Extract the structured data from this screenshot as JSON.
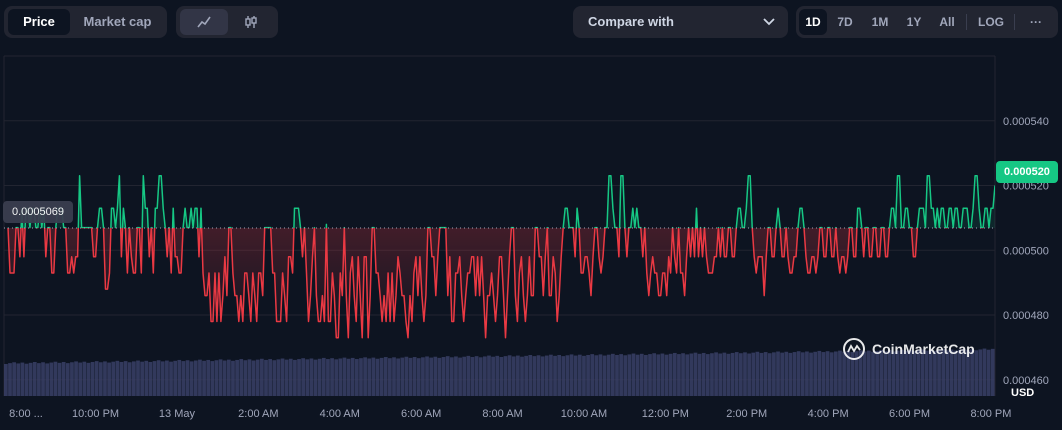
{
  "toolbar": {
    "view_tabs": [
      "Price",
      "Market cap"
    ],
    "active_view": "Price",
    "chart_styles": [
      "line-chart-icon",
      "candlestick-icon"
    ],
    "compare_label": "Compare with",
    "ranges": [
      "1D",
      "7D",
      "1M",
      "1Y",
      "All"
    ],
    "active_range": "1D",
    "log_label": "LOG",
    "more_label": "···"
  },
  "current_price_label": "0.000520",
  "reference_price_label": "0.0005069",
  "watermark": "CoinMarketCap",
  "currency": "USD",
  "colors": {
    "up": "#16c784",
    "down": "#ea3943",
    "background": "#0d1421",
    "grid": "#222531",
    "volume": "#3a3f66"
  },
  "chart_data": {
    "type": "line",
    "title": "",
    "xlabel": "",
    "ylabel": "USD",
    "reference_value": 0.0005069,
    "ylim": [
      0.000455,
      0.00056
    ],
    "ytick_values": [
      0.00046,
      0.00048,
      0.0005,
      0.00052,
      0.00054
    ],
    "ytick_labels": [
      "0.000460",
      "0.000480",
      "0.000500",
      "0.000520",
      "0.000540"
    ],
    "xtick_labels": [
      "8:00 ...",
      "10:00 PM",
      "13 May",
      "2:00 AM",
      "4:00 AM",
      "6:00 AM",
      "8:00 AM",
      "10:00 AM",
      "12:00 PM",
      "2:00 PM",
      "4:00 PM",
      "6:00 PM",
      "8:00 PM"
    ],
    "xtick_hours": [
      20,
      22,
      24,
      26,
      28,
      30,
      32,
      34,
      36,
      38,
      40,
      42,
      44
    ],
    "x_range_hours": [
      19.75,
      44.1
    ],
    "series": [
      {
        "values": [
          0.000507,
          0.000493,
          0.000493,
          0.000493,
          0.000507,
          0.000507,
          0.000498,
          0.000513,
          0.000498,
          0.000513,
          0.000513,
          0.000507,
          0.000513,
          0.000513,
          0.000507,
          0.000507,
          0.000513,
          0.000507,
          0.000513,
          0.000498,
          0.000507,
          0.000507,
          0.000493,
          0.000493,
          0.000507,
          0.000513,
          0.000513,
          0.000513,
          0.000507,
          0.000507,
          0.000493,
          0.000493,
          0.000498,
          0.000493,
          0.000498,
          0.000498,
          0.000523,
          0.000507,
          0.000507,
          0.000507,
          0.000507,
          0.000507,
          0.000507,
          0.000498,
          0.000498,
          0.000507,
          0.000513,
          0.000513,
          0.000507,
          0.000488,
          0.000488,
          0.000493,
          0.000513,
          0.000513,
          0.000507,
          0.000513,
          0.000523,
          0.000498,
          0.000513,
          0.000507,
          0.000493,
          0.000507,
          0.000498,
          0.000493,
          0.000493,
          0.000507,
          0.000507,
          0.000493,
          0.000523,
          0.000513,
          0.000513,
          0.000498,
          0.000507,
          0.000493,
          0.000513,
          0.000513,
          0.000523,
          0.000523,
          0.000513,
          0.000507,
          0.000498,
          0.000507,
          0.000493,
          0.000513,
          0.000498,
          0.000498,
          0.000493,
          0.000493,
          0.000507,
          0.000513,
          0.000507,
          0.000507,
          0.000513,
          0.000507,
          0.000513,
          0.000513,
          0.000498,
          0.000513,
          0.000493,
          0.000486,
          0.000486,
          0.000493,
          0.000478,
          0.000478,
          0.000493,
          0.000478,
          0.000493,
          0.000478,
          0.000486,
          0.000498,
          0.000486,
          0.000507,
          0.000507,
          0.000493,
          0.000486,
          0.000486,
          0.000478,
          0.000486,
          0.000478,
          0.000493,
          0.000493,
          0.000486,
          0.000478,
          0.000493,
          0.000486,
          0.000478,
          0.000493,
          0.000493,
          0.000486,
          0.000507,
          0.000507,
          0.000507,
          0.000507,
          0.000493,
          0.000493,
          0.000478,
          0.000478,
          0.000478,
          0.000493,
          0.000486,
          0.000478,
          0.000498,
          0.000498,
          0.000493,
          0.000513,
          0.000513,
          0.000513,
          0.000507,
          0.000498,
          0.000507,
          0.000493,
          0.000478,
          0.000486,
          0.000498,
          0.000507,
          0.000486,
          0.000478,
          0.000478,
          0.000486,
          0.000478,
          0.000508,
          0.000478,
          0.000478,
          0.000493,
          0.000486,
          0.000473,
          0.000473,
          0.000493,
          0.000486,
          0.000507,
          0.000486,
          0.000473,
          0.000493,
          0.000498,
          0.000486,
          0.000478,
          0.000498,
          0.000486,
          0.000473,
          0.000498,
          0.000498,
          0.000473,
          0.000486,
          0.000507,
          0.000507,
          0.000493,
          0.000493,
          0.000486,
          0.000478,
          0.000486,
          0.000478,
          0.000493,
          0.000478,
          0.000493,
          0.000478,
          0.000486,
          0.000498,
          0.000493,
          0.000486,
          0.000486,
          0.000478,
          0.000473,
          0.000486,
          0.000478,
          0.000493,
          0.000498,
          0.000486,
          0.000498,
          0.000486,
          0.000478,
          0.000486,
          0.000507,
          0.000507,
          0.000498,
          0.000498,
          0.000486,
          0.000498,
          0.000507,
          0.000507,
          0.000507,
          0.000507,
          0.000486,
          0.000498,
          0.000478,
          0.000478,
          0.000493,
          0.000493,
          0.000498,
          0.000486,
          0.000478,
          0.000486,
          0.000493,
          0.000493,
          0.000498,
          0.000498,
          0.000486,
          0.000498,
          0.000486,
          0.000498,
          0.000486,
          0.000473,
          0.000486,
          0.000486,
          0.000493,
          0.000486,
          0.000478,
          0.000486,
          0.000498,
          0.000498,
          0.000486,
          0.000473,
          0.000486,
          0.000498,
          0.000507,
          0.000507,
          0.000486,
          0.000478,
          0.000493,
          0.000498,
          0.000486,
          0.000478,
          0.000486,
          0.000498,
          0.000486,
          0.000486,
          0.000507,
          0.000507,
          0.000498,
          0.000498,
          0.000486,
          0.000498,
          0.000507,
          0.000486,
          0.000486,
          0.000498,
          0.000493,
          0.000478,
          0.000486,
          0.000498,
          0.000507,
          0.000513,
          0.000513,
          0.000507,
          0.000507,
          0.000507,
          0.000498,
          0.000513,
          0.000507,
          0.000493,
          0.000493,
          0.000498,
          0.000498,
          0.000493,
          0.000486,
          0.000498,
          0.000507,
          0.000507,
          0.000498,
          0.000493,
          0.000498,
          0.000507,
          0.000507,
          0.000523,
          0.000523,
          0.000513,
          0.000507,
          0.000507,
          0.000498,
          0.000523,
          0.000523,
          0.000507,
          0.000498,
          0.000507,
          0.000507,
          0.000513,
          0.000507,
          0.000513,
          0.000507,
          0.000507,
          0.000498,
          0.000507,
          0.000493,
          0.000486,
          0.000493,
          0.000498,
          0.000493,
          0.000493,
          0.000486,
          0.000486,
          0.000493,
          0.000493,
          0.000486,
          0.000498,
          0.000493,
          0.000507,
          0.000498,
          0.000493,
          0.000507,
          0.000493,
          0.000493,
          0.000486,
          0.000498,
          0.000507,
          0.000498,
          0.000507,
          0.000498,
          0.000513,
          0.000498,
          0.000507,
          0.000498,
          0.000507,
          0.000498,
          0.000493,
          0.000493,
          0.000493,
          0.000498,
          0.000498,
          0.000507,
          0.000498,
          0.000507,
          0.000498,
          0.000498,
          0.000507,
          0.000507,
          0.000498,
          0.000498,
          0.000507,
          0.000513,
          0.000513,
          0.000507,
          0.000507,
          0.000513,
          0.000523,
          0.000523,
          0.000507,
          0.000498,
          0.000493,
          0.000498,
          0.000498,
          0.000498,
          0.000486,
          0.000498,
          0.000507,
          0.000507,
          0.000498,
          0.000498,
          0.000507,
          0.000513,
          0.000507,
          0.000498,
          0.000498,
          0.000507,
          0.000498,
          0.000493,
          0.000493,
          0.000498,
          0.000498,
          0.000507,
          0.000513,
          0.000513,
          0.000507,
          0.000498,
          0.000493,
          0.000493,
          0.000498,
          0.000498,
          0.000493,
          0.000498,
          0.000507,
          0.000507,
          0.000498,
          0.000498,
          0.000507,
          0.000507,
          0.000498,
          0.000498,
          0.000507,
          0.000498,
          0.000493,
          0.000498,
          0.000498,
          0.000493,
          0.000498,
          0.000507,
          0.000507,
          0.000498,
          0.000498,
          0.000513,
          0.000513,
          0.000507,
          0.000498,
          0.000507,
          0.000507,
          0.000498,
          0.000498,
          0.000507,
          0.000507,
          0.000498,
          0.000498,
          0.000507,
          0.000507,
          0.000498,
          0.000498,
          0.000507,
          0.000513,
          0.000513,
          0.000507,
          0.000523,
          0.000523,
          0.000507,
          0.000507,
          0.000513,
          0.000513,
          0.000507,
          0.000507,
          0.000498,
          0.000498,
          0.000507,
          0.000513,
          0.000513,
          0.000513,
          0.000507,
          0.000523,
          0.000523,
          0.000513,
          0.000513,
          0.000507,
          0.000513,
          0.000507,
          0.000513,
          0.000513,
          0.000507,
          0.000507,
          0.000513,
          0.000513,
          0.000507,
          0.000513,
          0.000513,
          0.000507,
          0.000507,
          0.000513,
          0.000513,
          0.000513,
          0.000507,
          0.000507,
          0.000513,
          0.000523,
          0.000523,
          0.000513,
          0.000507,
          0.000507,
          0.000513,
          0.000513,
          0.000507,
          0.000513,
          0.000513,
          0.00052
        ]
      }
    ]
  }
}
